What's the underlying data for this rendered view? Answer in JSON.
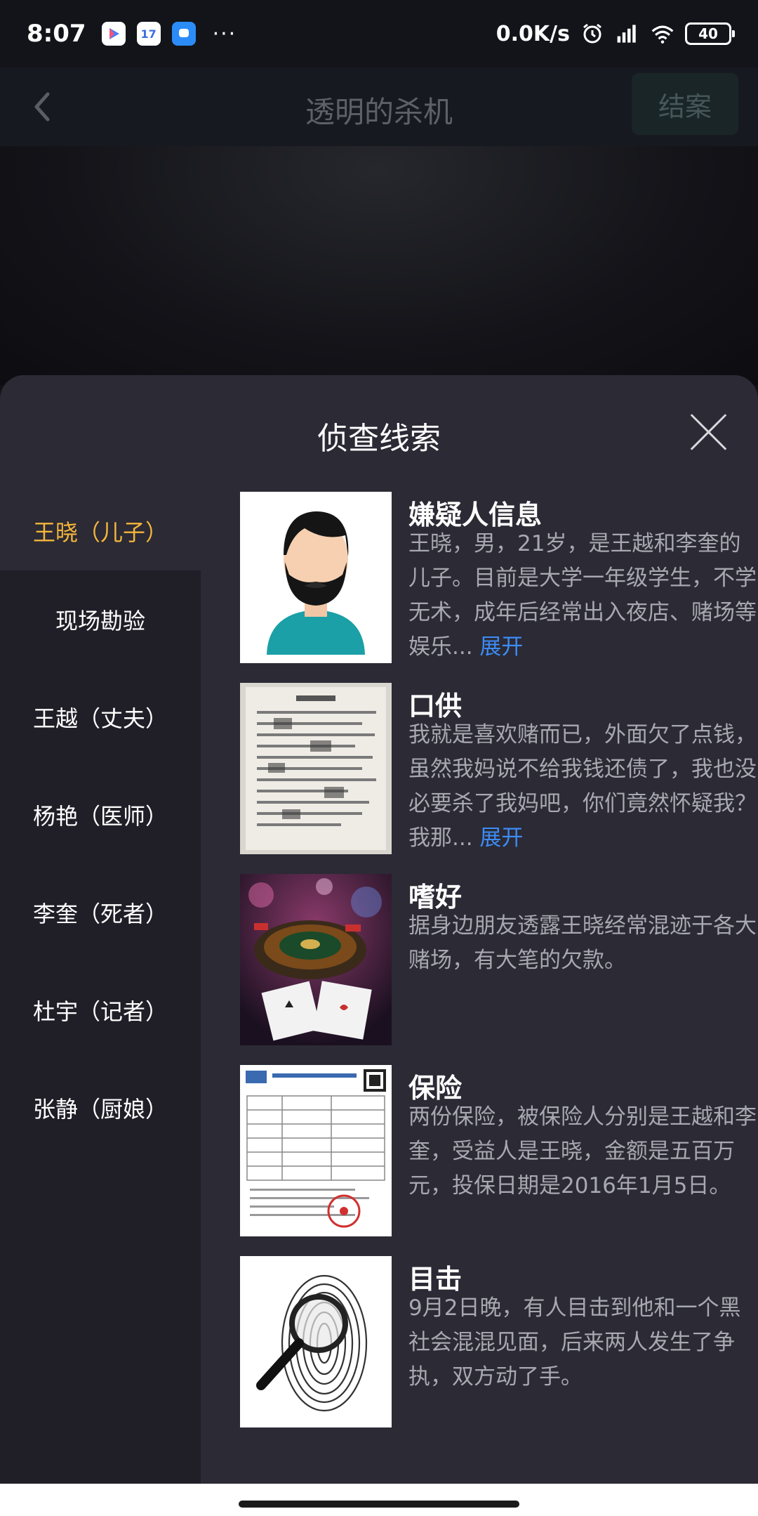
{
  "status_bar": {
    "time": "8:07",
    "dots": "···",
    "net_speed": "0.0K/s",
    "battery": "40",
    "icons": [
      "play-store-icon",
      "calendar-icon",
      "messenger-icon",
      "alarm-icon",
      "signal-icon",
      "wifi-icon",
      "battery-icon"
    ],
    "calendar_day": "17"
  },
  "header": {
    "title": "透明的杀机",
    "close_case_label": "结案"
  },
  "sheet": {
    "title": "侦查线索",
    "sidebar": [
      {
        "label": "王晓（儿子）",
        "active": true
      },
      {
        "label": "现场勘验",
        "active": false
      },
      {
        "label": "王越（丈夫）",
        "active": false
      },
      {
        "label": "杨艳（医师）",
        "active": false
      },
      {
        "label": "李奎（死者）",
        "active": false
      },
      {
        "label": "杜宇（记者）",
        "active": false
      },
      {
        "label": "张静（厨娘）",
        "active": false
      }
    ],
    "clues": [
      {
        "title": "嫌疑人信息",
        "desc": "王晓，男，21岁，是王越和李奎的儿子。目前是大学一年级学生，不学无术，成年后经常出入夜店、赌场等娱乐...",
        "expand": "展开",
        "thumb": "suspect-avatar"
      },
      {
        "title": "口供",
        "desc": "我就是喜欢赌而已，外面欠了点钱，虽然我妈说不给我钱还债了，我也没必要杀了我妈吧，你们竟然怀疑我？我那...",
        "expand": "展开",
        "thumb": "statement-document"
      },
      {
        "title": "嗜好",
        "desc": "据身边朋友透露王晓经常混迹于各大赌场，有大笔的欠款。",
        "expand": "",
        "thumb": "casino-roulette"
      },
      {
        "title": "保险",
        "desc": "两份保险，被保险人分别是王越和李奎，受益人是王晓，金额是五百万元，投保日期是2016年1月5日。",
        "expand": "",
        "thumb": "insurance-document"
      },
      {
        "title": "目击",
        "desc": "9月2日晚，有人目击到他和一个黑社会混混见面，后来两人发生了争执，双方动了手。",
        "expand": "",
        "thumb": "fingerprint-magnifier"
      }
    ]
  },
  "colors": {
    "sheet_bg": "#2b2a35",
    "sidebar_bg": "#201f28",
    "active_tab": "#f5b53a",
    "link": "#3d8cf5",
    "desc_text": "#a8a8b0"
  }
}
